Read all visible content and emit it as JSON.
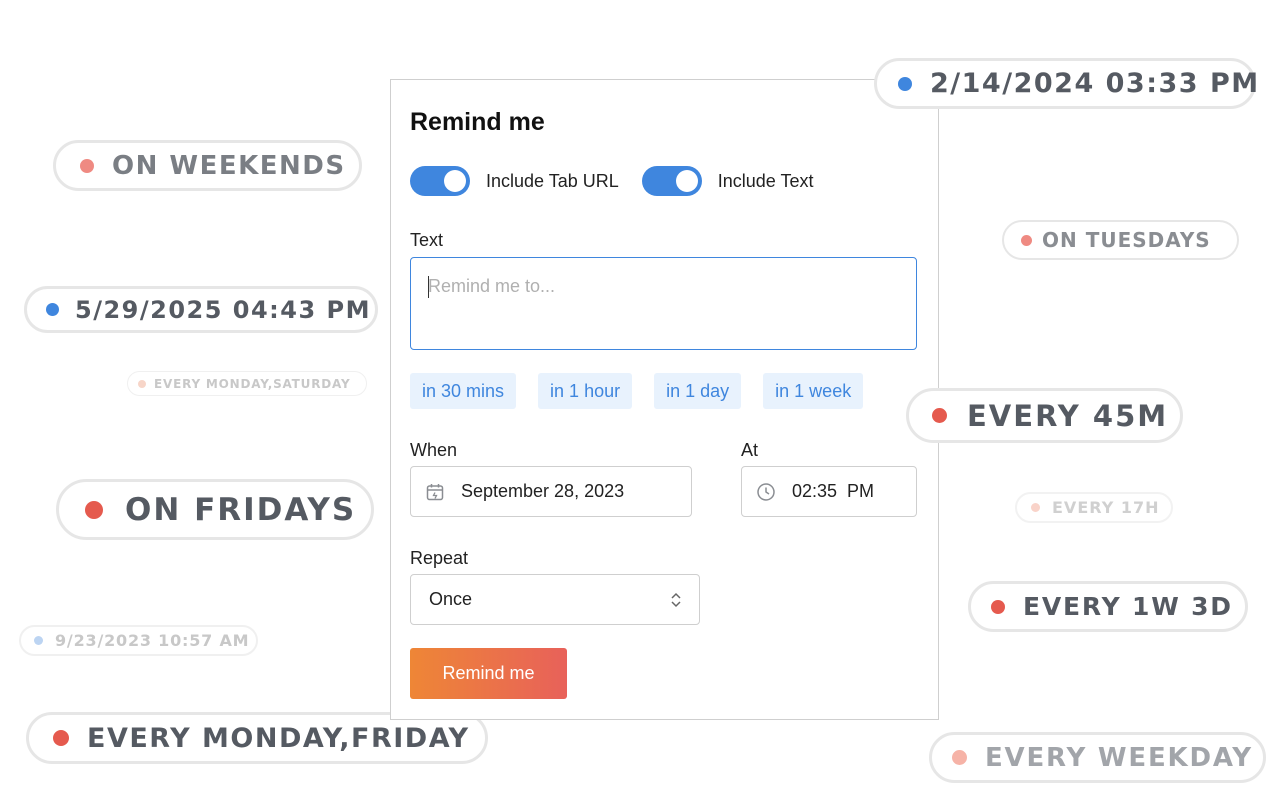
{
  "pills": {
    "on_weekends": "ON WEEKENDS",
    "date_2024": "2/14/2024 03:33 PM",
    "on_tuesdays": "ON TUESDAYS",
    "date_2025": "5/29/2025 04:43 PM",
    "every_monday_saturday": "EVERY MONDAY,SATURDAY",
    "every_45m": "EVERY 45M",
    "on_fridays": "ON FRIDAYS",
    "every_17h": "EVERY 17H",
    "every_1w_3d": "EVERY 1W 3D",
    "date_2023": "9/23/2023 10:57 AM",
    "every_monday_friday": "EVERY MONDAY,FRIDAY",
    "every_weekday": "EVERY WEEKDAY"
  },
  "form": {
    "title": "Remind me",
    "toggles": [
      {
        "label": "Include Tab URL",
        "on": true
      },
      {
        "label": "Include Text",
        "on": true
      }
    ],
    "text_label": "Text",
    "text_placeholder": "Remind me to...",
    "quick_chips": [
      "in 30 mins",
      "in 1 hour",
      "in 1 day",
      "in 1 week"
    ],
    "when_label": "When",
    "when_value": "September 28, 2023",
    "at_label": "At",
    "at_value": "02:35  PM",
    "repeat_label": "Repeat",
    "repeat_value": "Once",
    "submit_label": "Remind me"
  },
  "colors": {
    "accent_blue": "#3f86de",
    "accent_red": "#e55a4e",
    "button_gradient_start": "#ee8636",
    "button_gradient_end": "#e8615a"
  }
}
